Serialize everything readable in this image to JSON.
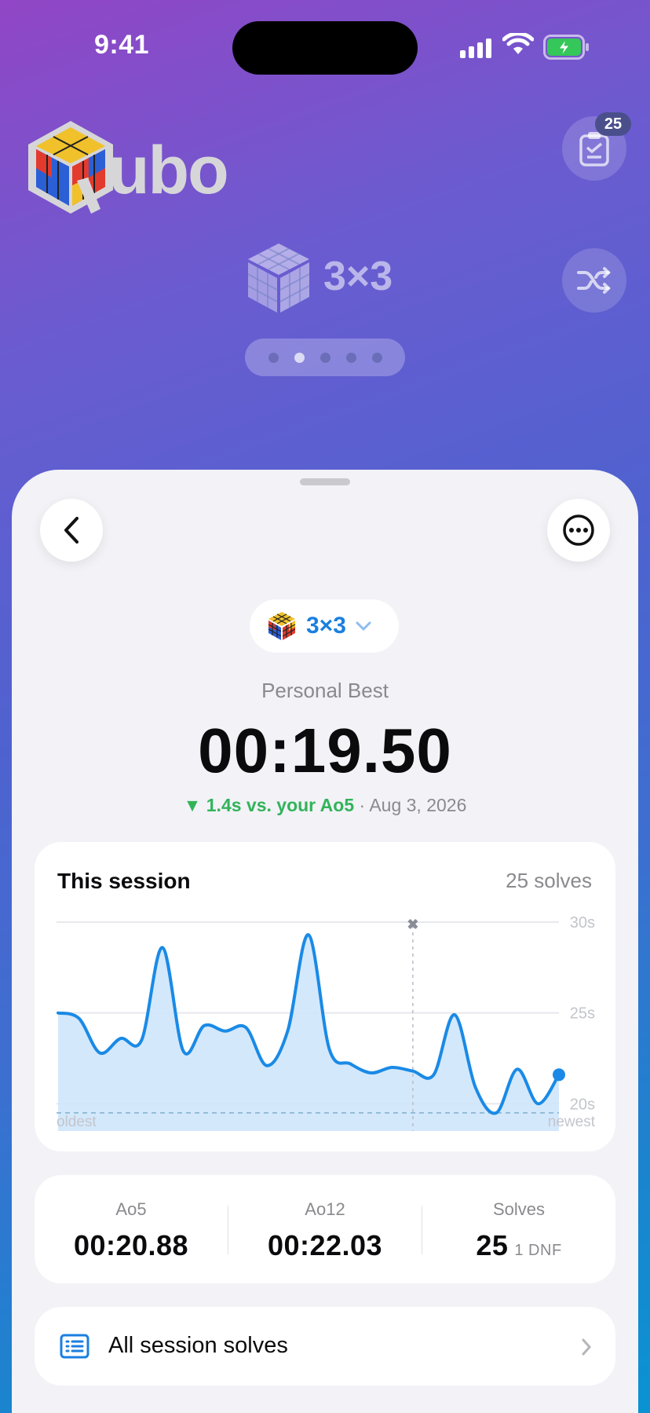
{
  "status_bar": {
    "time": "9:41"
  },
  "header": {
    "logo_text": "ubo",
    "logo_alt": "Qubo",
    "badge_count": "25",
    "puzzle_title": "3×3",
    "page_dots": 5,
    "active_dot": 1
  },
  "sheet": {
    "puzzle_selector": "3×3",
    "pb_label": "Personal Best",
    "pb_value": "00:19.50",
    "pb_delta": "▼ 1.4s vs. your Ao5",
    "pb_separator": "·",
    "pb_date": "Aug 3, 2026"
  },
  "session": {
    "title": "This session",
    "count": "25 solves"
  },
  "chart_data": {
    "type": "area",
    "title": "This session",
    "x_labels": {
      "left": "oldest",
      "right": "newest"
    },
    "y_ticks": [
      "30s",
      "25s",
      "20s"
    ],
    "ylim": [
      18.5,
      30
    ],
    "values": [
      25.0,
      24.7,
      22.8,
      23.6,
      23.5,
      28.6,
      22.9,
      24.3,
      24.0,
      24.2,
      22.1,
      24.0,
      29.3,
      23.0,
      22.2,
      21.7,
      22.0,
      21.8,
      21.6,
      24.9,
      20.9,
      19.5,
      21.9,
      20.0,
      21.6
    ],
    "dnf_index": 17,
    "reference_line": 19.5,
    "color": "#1a8ae6",
    "fill": "#cfe5fb"
  },
  "stats": [
    {
      "label": "Ao5",
      "value": "00:20.88"
    },
    {
      "label": "Ao12",
      "value": "00:22.03"
    },
    {
      "label": "Solves",
      "value": "25",
      "sub": "1 DNF"
    }
  ],
  "list": {
    "all_solves_label": "All session solves"
  }
}
